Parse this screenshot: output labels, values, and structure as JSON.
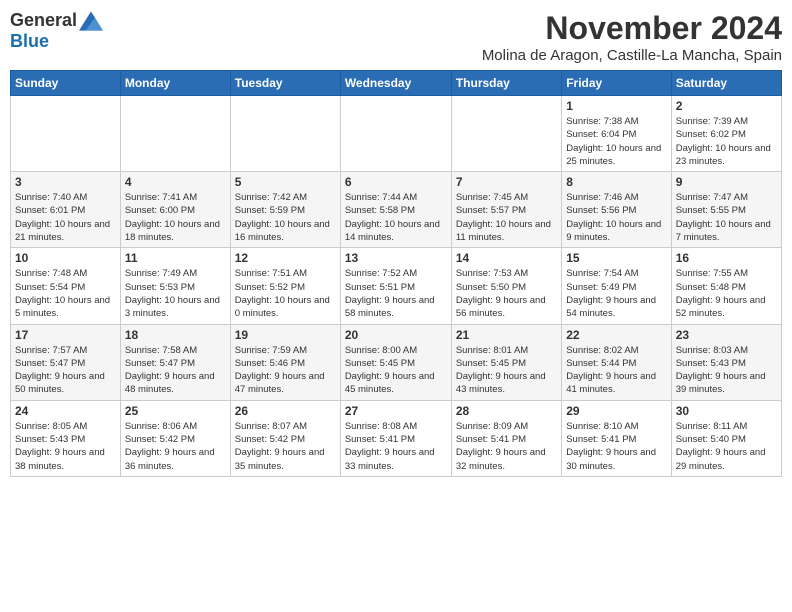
{
  "logo": {
    "general": "General",
    "blue": "Blue"
  },
  "title": "November 2024",
  "location": "Molina de Aragon, Castille-La Mancha, Spain",
  "weekdays": [
    "Sunday",
    "Monday",
    "Tuesday",
    "Wednesday",
    "Thursday",
    "Friday",
    "Saturday"
  ],
  "weeks": [
    [
      {
        "day": "",
        "sunrise": "",
        "sunset": "",
        "daylight": ""
      },
      {
        "day": "",
        "sunrise": "",
        "sunset": "",
        "daylight": ""
      },
      {
        "day": "",
        "sunrise": "",
        "sunset": "",
        "daylight": ""
      },
      {
        "day": "",
        "sunrise": "",
        "sunset": "",
        "daylight": ""
      },
      {
        "day": "",
        "sunrise": "",
        "sunset": "",
        "daylight": ""
      },
      {
        "day": "1",
        "sunrise": "Sunrise: 7:38 AM",
        "sunset": "Sunset: 6:04 PM",
        "daylight": "Daylight: 10 hours and 25 minutes."
      },
      {
        "day": "2",
        "sunrise": "Sunrise: 7:39 AM",
        "sunset": "Sunset: 6:02 PM",
        "daylight": "Daylight: 10 hours and 23 minutes."
      }
    ],
    [
      {
        "day": "3",
        "sunrise": "Sunrise: 7:40 AM",
        "sunset": "Sunset: 6:01 PM",
        "daylight": "Daylight: 10 hours and 21 minutes."
      },
      {
        "day": "4",
        "sunrise": "Sunrise: 7:41 AM",
        "sunset": "Sunset: 6:00 PM",
        "daylight": "Daylight: 10 hours and 18 minutes."
      },
      {
        "day": "5",
        "sunrise": "Sunrise: 7:42 AM",
        "sunset": "Sunset: 5:59 PM",
        "daylight": "Daylight: 10 hours and 16 minutes."
      },
      {
        "day": "6",
        "sunrise": "Sunrise: 7:44 AM",
        "sunset": "Sunset: 5:58 PM",
        "daylight": "Daylight: 10 hours and 14 minutes."
      },
      {
        "day": "7",
        "sunrise": "Sunrise: 7:45 AM",
        "sunset": "Sunset: 5:57 PM",
        "daylight": "Daylight: 10 hours and 11 minutes."
      },
      {
        "day": "8",
        "sunrise": "Sunrise: 7:46 AM",
        "sunset": "Sunset: 5:56 PM",
        "daylight": "Daylight: 10 hours and 9 minutes."
      },
      {
        "day": "9",
        "sunrise": "Sunrise: 7:47 AM",
        "sunset": "Sunset: 5:55 PM",
        "daylight": "Daylight: 10 hours and 7 minutes."
      }
    ],
    [
      {
        "day": "10",
        "sunrise": "Sunrise: 7:48 AM",
        "sunset": "Sunset: 5:54 PM",
        "daylight": "Daylight: 10 hours and 5 minutes."
      },
      {
        "day": "11",
        "sunrise": "Sunrise: 7:49 AM",
        "sunset": "Sunset: 5:53 PM",
        "daylight": "Daylight: 10 hours and 3 minutes."
      },
      {
        "day": "12",
        "sunrise": "Sunrise: 7:51 AM",
        "sunset": "Sunset: 5:52 PM",
        "daylight": "Daylight: 10 hours and 0 minutes."
      },
      {
        "day": "13",
        "sunrise": "Sunrise: 7:52 AM",
        "sunset": "Sunset: 5:51 PM",
        "daylight": "Daylight: 9 hours and 58 minutes."
      },
      {
        "day": "14",
        "sunrise": "Sunrise: 7:53 AM",
        "sunset": "Sunset: 5:50 PM",
        "daylight": "Daylight: 9 hours and 56 minutes."
      },
      {
        "day": "15",
        "sunrise": "Sunrise: 7:54 AM",
        "sunset": "Sunset: 5:49 PM",
        "daylight": "Daylight: 9 hours and 54 minutes."
      },
      {
        "day": "16",
        "sunrise": "Sunrise: 7:55 AM",
        "sunset": "Sunset: 5:48 PM",
        "daylight": "Daylight: 9 hours and 52 minutes."
      }
    ],
    [
      {
        "day": "17",
        "sunrise": "Sunrise: 7:57 AM",
        "sunset": "Sunset: 5:47 PM",
        "daylight": "Daylight: 9 hours and 50 minutes."
      },
      {
        "day": "18",
        "sunrise": "Sunrise: 7:58 AM",
        "sunset": "Sunset: 5:47 PM",
        "daylight": "Daylight: 9 hours and 48 minutes."
      },
      {
        "day": "19",
        "sunrise": "Sunrise: 7:59 AM",
        "sunset": "Sunset: 5:46 PM",
        "daylight": "Daylight: 9 hours and 47 minutes."
      },
      {
        "day": "20",
        "sunrise": "Sunrise: 8:00 AM",
        "sunset": "Sunset: 5:45 PM",
        "daylight": "Daylight: 9 hours and 45 minutes."
      },
      {
        "day": "21",
        "sunrise": "Sunrise: 8:01 AM",
        "sunset": "Sunset: 5:45 PM",
        "daylight": "Daylight: 9 hours and 43 minutes."
      },
      {
        "day": "22",
        "sunrise": "Sunrise: 8:02 AM",
        "sunset": "Sunset: 5:44 PM",
        "daylight": "Daylight: 9 hours and 41 minutes."
      },
      {
        "day": "23",
        "sunrise": "Sunrise: 8:03 AM",
        "sunset": "Sunset: 5:43 PM",
        "daylight": "Daylight: 9 hours and 39 minutes."
      }
    ],
    [
      {
        "day": "24",
        "sunrise": "Sunrise: 8:05 AM",
        "sunset": "Sunset: 5:43 PM",
        "daylight": "Daylight: 9 hours and 38 minutes."
      },
      {
        "day": "25",
        "sunrise": "Sunrise: 8:06 AM",
        "sunset": "Sunset: 5:42 PM",
        "daylight": "Daylight: 9 hours and 36 minutes."
      },
      {
        "day": "26",
        "sunrise": "Sunrise: 8:07 AM",
        "sunset": "Sunset: 5:42 PM",
        "daylight": "Daylight: 9 hours and 35 minutes."
      },
      {
        "day": "27",
        "sunrise": "Sunrise: 8:08 AM",
        "sunset": "Sunset: 5:41 PM",
        "daylight": "Daylight: 9 hours and 33 minutes."
      },
      {
        "day": "28",
        "sunrise": "Sunrise: 8:09 AM",
        "sunset": "Sunset: 5:41 PM",
        "daylight": "Daylight: 9 hours and 32 minutes."
      },
      {
        "day": "29",
        "sunrise": "Sunrise: 8:10 AM",
        "sunset": "Sunset: 5:41 PM",
        "daylight": "Daylight: 9 hours and 30 minutes."
      },
      {
        "day": "30",
        "sunrise": "Sunrise: 8:11 AM",
        "sunset": "Sunset: 5:40 PM",
        "daylight": "Daylight: 9 hours and 29 minutes."
      }
    ]
  ]
}
